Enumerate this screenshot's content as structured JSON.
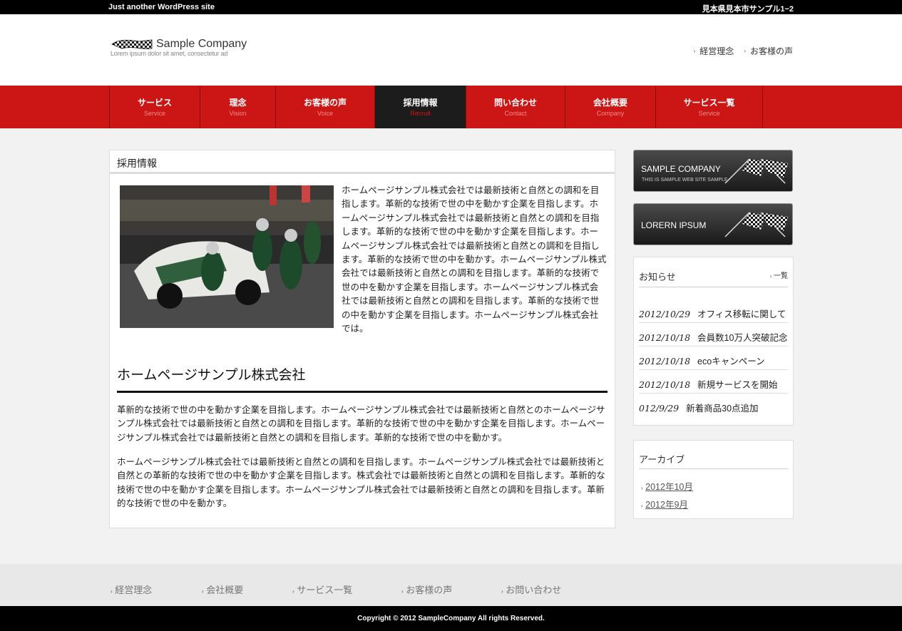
{
  "topbar": {
    "tagline": "Just another WordPress site",
    "address": "見本県見本市サンプル1−2"
  },
  "header": {
    "logo_name": "Sample Company",
    "logo_sub": "Lorem ipsum dolor sit amet, consectetur ad",
    "links": [
      "経営理念",
      "お客様の声"
    ]
  },
  "nav": {
    "items": [
      {
        "jp": "サービス",
        "en": "Service"
      },
      {
        "jp": "理念",
        "en": "Vision"
      },
      {
        "jp": "お客様の声",
        "en": "Voice"
      },
      {
        "jp": "採用情報",
        "en": "Recruit"
      },
      {
        "jp": "問い合わせ",
        "en": "Contact"
      },
      {
        "jp": "会社概要",
        "en": "Company"
      },
      {
        "jp": "サービス一覧",
        "en": "Service"
      }
    ],
    "active_index": 3
  },
  "main": {
    "title": "採用情報",
    "intro": "ホームページサンプル株式会社では最新技術と自然との調和を目指します。革新的な技術で世の中を動かす企業を目指します。ホームページサンプル株式会社では最新技術と自然との調和を目指します。革新的な技術で世の中を動かす企業を目指します。ホームページサンプル株式会社では最新技術と自然との調和を目指します。革新的な技術で世の中を動かす。ホームページサンプル株式会社では最新技術と自然との調和を目指します。革新的な技術で世の中を動かす企業を目指します。ホームページサンプル株式会社では最新技術と自然との調和を目指します。革新的な技術で世の中を動かす企業を目指します。ホームページサンプル株式会社では。",
    "heading": "ホームページサンプル株式会社",
    "para1": "革新的な技術で世の中を動かす企業を目指します。ホームページサンプル株式会社では最新技術と自然とのホームページサンプル株式会社では最新技術と自然との調和を目指します。革新的な技術で世の中を動かす企業を目指します。ホームページサンプル株式会社では最新技術と自然との調和を目指します。革新的な技術で世の中を動かす。",
    "para2": "ホームページサンプル株式会社では最新技術と自然との調和を目指します。ホームページサンプル株式会社では最新技術と自然との革新的な技術で世の中を動かす企業を目指します。株式会社では最新技術と自然との調和を目指します。革新的な技術で世の中を動かす企業を目指します。ホームページサンプル株式会社では最新技術と自然との調和を目指します。革新的な技術で世の中を動かす。"
  },
  "sidebar": {
    "banner1": {
      "title": "SAMPLE COMPANY",
      "sub": "THIS IS SAMPLE WEB SITE SAMPLE"
    },
    "banner2": {
      "title": "LORERN IPSUM"
    },
    "news": {
      "title": "お知らせ",
      "more": "一覧",
      "items": [
        {
          "date": "2012/10/29",
          "text": "オフィス移転に関して"
        },
        {
          "date": "2012/10/18",
          "text": "会員数10万人突破記念"
        },
        {
          "date": "2012/10/18",
          "text": "ecoキャンペーン"
        },
        {
          "date": "2012/10/18",
          "text": "新規サービスを開始"
        },
        {
          "date": "012/9/29",
          "text": "新着商品30点追加"
        }
      ]
    },
    "archive": {
      "title": "アーカイブ",
      "items": [
        "2012年10月",
        "2012年9月"
      ]
    }
  },
  "footer": {
    "links": [
      "経営理念",
      "会社概要",
      "サービス一覧",
      "お客様の声",
      "お問い合わせ"
    ],
    "copyright": "Copyright © 2012 SampleCompany All rights Reserved."
  },
  "colors": {
    "nav_red": "#cc1616",
    "nav_active": "#1c1c1c",
    "topbar": "#000000"
  }
}
